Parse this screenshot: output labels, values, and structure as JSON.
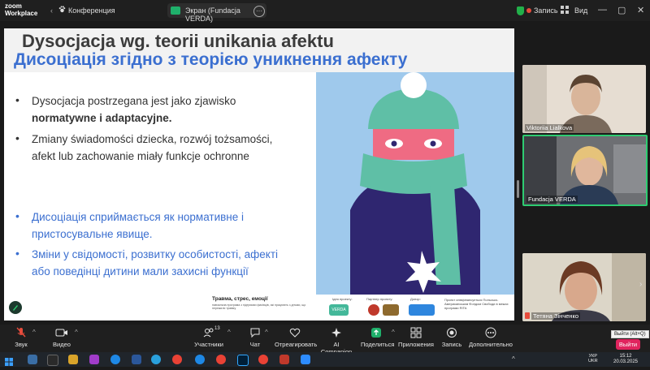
{
  "window": {
    "app_logo_line1": "zoom",
    "app_logo_line2": "Workplace",
    "conference_label": "Конференция",
    "share_label": "Экран (Fundacja VERDA)",
    "record_label": "Запись",
    "view_label": "Вид"
  },
  "slide": {
    "title_pl": "Dysocjacja wg. teorii unikania afektu",
    "title_ua": "Дисоціація згідно з теорією уникнення афекту",
    "bullets_pl": [
      {
        "lines": [
          "Dysocjacja postrzegana jest jako zjawisko",
          "normatywne i adaptacyjne."
        ]
      },
      {
        "lines": [
          "Zmiany świadomości dziecka, rozwój tożsamości,",
          "afekt lub zachowanie miały funkcje ochronne"
        ]
      }
    ],
    "bullets_ua": [
      {
        "lines": [
          "Дисоціація сприймається як нормативне і",
          "пристосувальне явище."
        ]
      },
      {
        "lines": [
          "Зміни у свідомості, розвитку особистості, афекті",
          "або поведінці дитини мали захисні функції"
        ]
      }
    ],
    "footer_title": "Травма, стрес, емоції",
    "footer_fine": "навчальна програма з підтримки фахівців, які працюють з дітьми, що пережили травму",
    "footer_label_1": "Ідея проекту:",
    "footer_label_2": "Партнер проекту:",
    "footer_label_3": "Донор:",
    "footer_logo_1": "VERDA",
    "footer_right_text": "Проект співфінансується Польсько-Американським Фондом Свободи в межах програми RITA"
  },
  "participants": [
    {
      "name": "Viktoriia Lialkova"
    },
    {
      "name": "Fundacja VERDA"
    },
    {
      "name": "Тетяна Зінченко"
    }
  ],
  "toolbar": {
    "items": [
      {
        "label": "Звук",
        "icon": "mic-muted-icon"
      },
      {
        "label": "Видео",
        "icon": "video-icon"
      },
      {
        "label": "Участники",
        "icon": "participants-icon",
        "badge": "13"
      },
      {
        "label": "Чат",
        "icon": "chat-icon"
      },
      {
        "label": "Отреагировать",
        "icon": "heart-icon"
      },
      {
        "label": "AI Companion",
        "icon": "sparkle-icon"
      },
      {
        "label": "Поделиться",
        "icon": "share-icon"
      },
      {
        "label": "Приложения",
        "icon": "apps-icon"
      },
      {
        "label": "Запись",
        "icon": "record-icon"
      },
      {
        "label": "Дополнительно",
        "icon": "more-icon"
      }
    ],
    "leave_label": "Выйти",
    "leave_tooltip": "Выйти (Alt+Q)"
  },
  "taskbar": {
    "lang_line1": "УКР",
    "lang_line2": "UKR",
    "time": "15:12",
    "date": "20.03.2025"
  },
  "colors": {
    "accent_blue": "#3b6fd0",
    "leave_red": "#e0245e",
    "share_green": "#1fb06b",
    "active_speaker": "#2ecc71"
  }
}
